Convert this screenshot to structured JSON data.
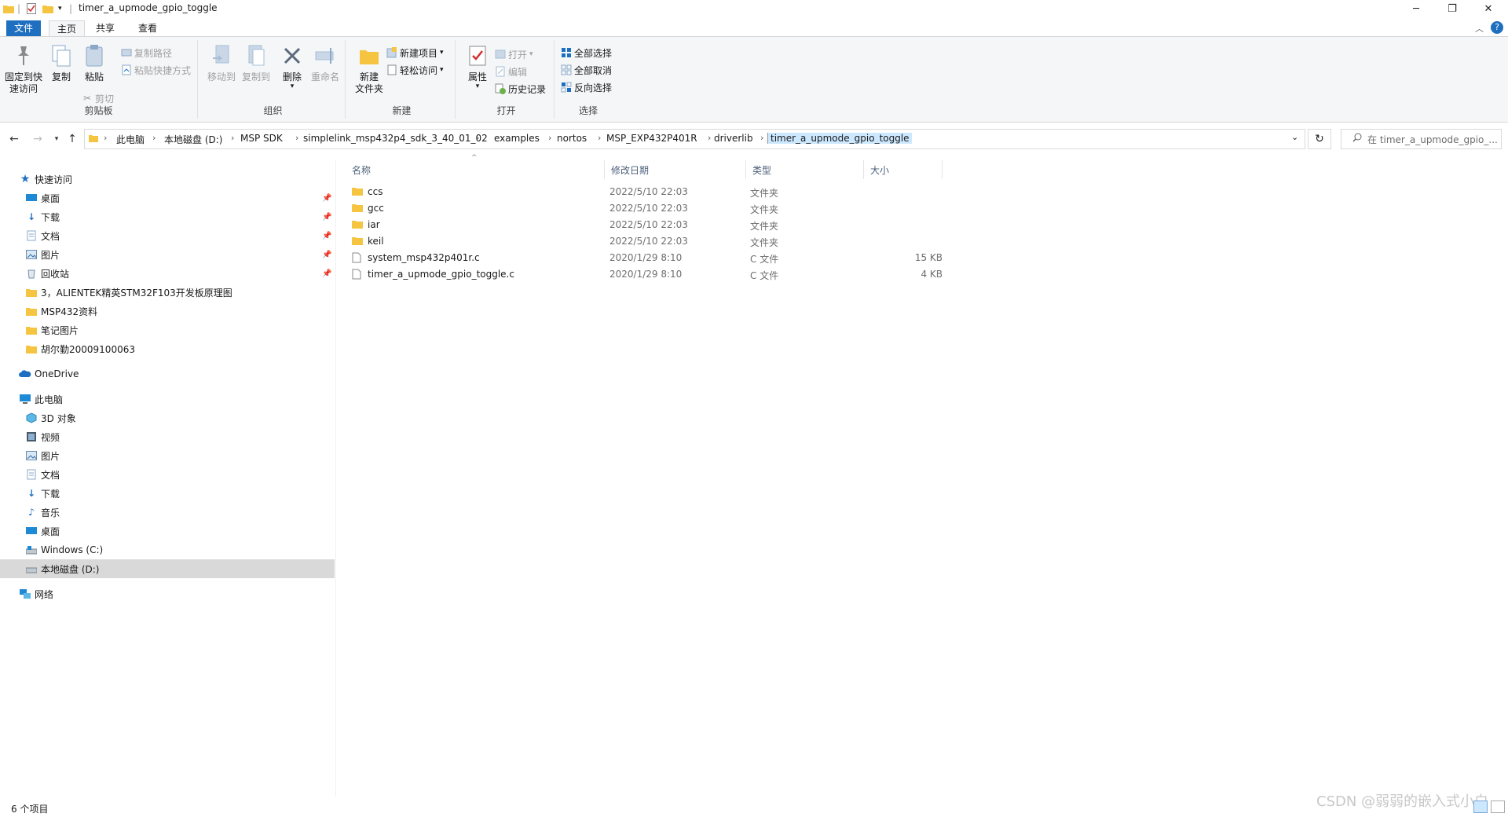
{
  "window": {
    "title": "timer_a_upmode_gpio_toggle",
    "controls": {
      "minimize": "─",
      "maximize": "❐",
      "close": "✕"
    }
  },
  "ribbon_tabs": [
    {
      "label": "文件"
    },
    {
      "label": "主页"
    },
    {
      "label": "共享"
    },
    {
      "label": "查看"
    }
  ],
  "ribbon": {
    "clipboard": {
      "group_label": "剪贴板",
      "pin_quick": "固定到快\n速访问",
      "copy": "复制",
      "paste": "粘贴",
      "copy_path": "复制路径",
      "paste_shortcut": "粘贴快捷方式",
      "cut": "剪切"
    },
    "organize": {
      "group_label": "组织",
      "move_to": "移动到",
      "copy_to": "复制到",
      "delete": "删除",
      "rename": "重命名"
    },
    "new": {
      "group_label": "新建",
      "new_folder": "新建\n文件夹",
      "new_item": "新建项目",
      "easy_access": "轻松访问"
    },
    "open": {
      "group_label": "打开",
      "properties": "属性",
      "open": "打开",
      "edit": "编辑",
      "history": "历史记录"
    },
    "select": {
      "group_label": "选择",
      "select_all": "全部选择",
      "select_none": "全部取消",
      "invert": "反向选择"
    }
  },
  "address": {
    "breadcrumbs": [
      "此电脑",
      "本地磁盘 (D:)",
      "MSP SDK",
      "simplelink_msp432p4_sdk_3_40_01_02",
      "examples",
      "nortos",
      "MSP_EXP432P401R",
      "driverlib"
    ],
    "current": "timer_a_upmode_gpio_toggle",
    "search_placeholder": "在 timer_a_upmode_gpio_..."
  },
  "nav_pane": {
    "quick_access": "快速访问",
    "quick_items": [
      {
        "label": "桌面",
        "icon": "desktop-icon",
        "pinned": true
      },
      {
        "label": "下载",
        "icon": "download-icon",
        "pinned": true
      },
      {
        "label": "文档",
        "icon": "document-icon",
        "pinned": true
      },
      {
        "label": "图片",
        "icon": "picture-icon",
        "pinned": true
      },
      {
        "label": "回收站",
        "icon": "recycle-bin-icon",
        "pinned": true
      },
      {
        "label": "3，ALIENTEK精英STM32F103开发板原理图",
        "icon": "folder-icon",
        "pinned": false
      },
      {
        "label": "MSP432资料",
        "icon": "folder-icon",
        "pinned": false
      },
      {
        "label": "笔记图片",
        "icon": "folder-icon",
        "pinned": false
      },
      {
        "label": "胡尔勤20009100063",
        "icon": "folder-icon",
        "pinned": false
      }
    ],
    "onedrive": "OneDrive",
    "this_pc": "此电脑",
    "pc_items": [
      {
        "label": "3D 对象",
        "icon": "3d-objects-icon"
      },
      {
        "label": "视频",
        "icon": "video-icon"
      },
      {
        "label": "图片",
        "icon": "picture-icon"
      },
      {
        "label": "文档",
        "icon": "document-icon"
      },
      {
        "label": "下载",
        "icon": "download-icon"
      },
      {
        "label": "音乐",
        "icon": "music-icon"
      },
      {
        "label": "桌面",
        "icon": "desktop-icon"
      },
      {
        "label": "Windows (C:)",
        "icon": "drive-icon"
      },
      {
        "label": "本地磁盘 (D:)",
        "icon": "drive-icon"
      }
    ],
    "network": "网络"
  },
  "file_list": {
    "columns": {
      "name": "名称",
      "modified": "修改日期",
      "type": "类型",
      "size": "大小"
    },
    "rows": [
      {
        "name": "ccs",
        "modified": "2022/5/10 22:03",
        "type": "文件夹",
        "size": "",
        "kind": "folder"
      },
      {
        "name": "gcc",
        "modified": "2022/5/10 22:03",
        "type": "文件夹",
        "size": "",
        "kind": "folder"
      },
      {
        "name": "iar",
        "modified": "2022/5/10 22:03",
        "type": "文件夹",
        "size": "",
        "kind": "folder"
      },
      {
        "name": "keil",
        "modified": "2022/5/10 22:03",
        "type": "文件夹",
        "size": "",
        "kind": "folder"
      },
      {
        "name": "system_msp432p401r.c",
        "modified": "2020/1/29 8:10",
        "type": "C 文件",
        "size": "15 KB",
        "kind": "file"
      },
      {
        "name": "timer_a_upmode_gpio_toggle.c",
        "modified": "2020/1/29 8:10",
        "type": "C 文件",
        "size": "4 KB",
        "kind": "file"
      }
    ]
  },
  "status": {
    "count": "6 个项目",
    "watermark": "CSDN @弱弱的嵌入式小白"
  },
  "colors": {
    "accent": "#1e6fc0",
    "folder": "#f5c542",
    "selected": "#d9d9d9",
    "current_crumb": "#cce8ff"
  }
}
